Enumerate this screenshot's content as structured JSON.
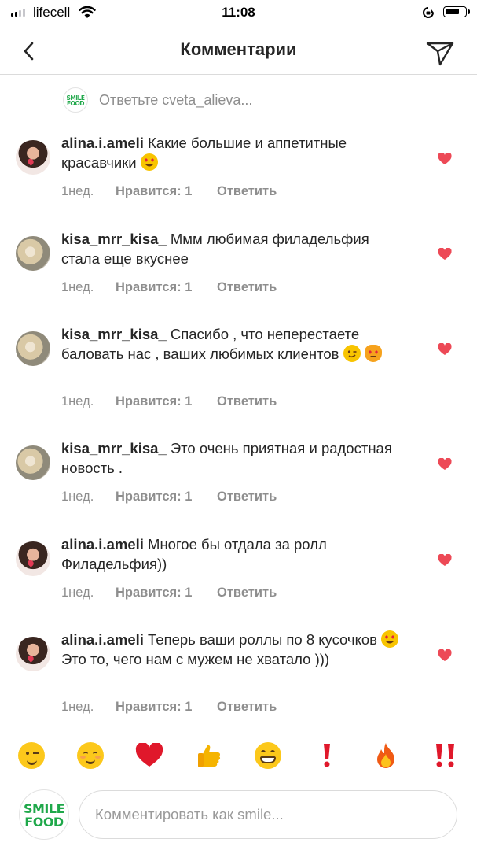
{
  "status_bar": {
    "carrier": "lifecell",
    "time": "11:08"
  },
  "header": {
    "title": "Комментарии"
  },
  "reply_prompt": {
    "text": "Ответьте cveta_alieva...",
    "logo_line1": "SMILE",
    "logo_line2": "FOOD"
  },
  "comments": [
    {
      "avatar": "alina",
      "username": "alina.i.ameli",
      "text": "Какие большие и аппетитные красавчики",
      "emoji": "heart-eyes-emoji",
      "time": "1нед.",
      "likes": "Нравится: 1",
      "reply": "Ответить",
      "liked": true
    },
    {
      "avatar": "kisa",
      "username": "kisa_mrr_kisa_",
      "text": "Ммм любимая филадельфия стала еще вкуснее",
      "time": "1нед.",
      "likes": "Нравится: 1",
      "reply": "Ответить",
      "liked": true
    },
    {
      "avatar": "kisa",
      "username": "kisa_mrr_kisa_",
      "text": "Спасибо , что неперестаете баловать нас , ваших любимых клиентов",
      "emoji": "wink-emoji",
      "emoji2": "heart-eyes-cat-emoji",
      "time": "1нед.",
      "likes": "Нравится: 1",
      "reply": "Ответить",
      "liked": true
    },
    {
      "avatar": "kisa",
      "username": "kisa_mrr_kisa_",
      "text": "Это очень приятная и радостная новость .",
      "time": "1нед.",
      "likes": "Нравится: 1",
      "reply": "Ответить",
      "liked": true
    },
    {
      "avatar": "alina",
      "username": "alina.i.ameli",
      "text": "Многое бы отдала за ролл Филадельфия))",
      "time": "1нед.",
      "likes": "Нравится: 1",
      "reply": "Ответить",
      "liked": true
    },
    {
      "avatar": "alina",
      "username": "alina.i.ameli",
      "text_before": "Теперь ваши роллы по 8 кусочков",
      "emoji": "heart-eyes-emoji",
      "text_after": "Это то, чего нам с мужем не хватало )))",
      "time": "1нед.",
      "likes": "Нравится: 1",
      "reply": "Ответить",
      "liked": true
    }
  ],
  "emoji_bar": [
    "wink",
    "smiling-blush",
    "red-heart",
    "thumbs-up",
    "grin",
    "exclamation",
    "fire",
    "double-exclamation"
  ],
  "composer": {
    "placeholder": "Комментировать как smile...",
    "logo_line1": "SMILE",
    "logo_line2": "FOOD"
  },
  "colors": {
    "heart": "#ed4956",
    "brand_green": "#1fa84a",
    "meta_gray": "#8e8e8e"
  }
}
